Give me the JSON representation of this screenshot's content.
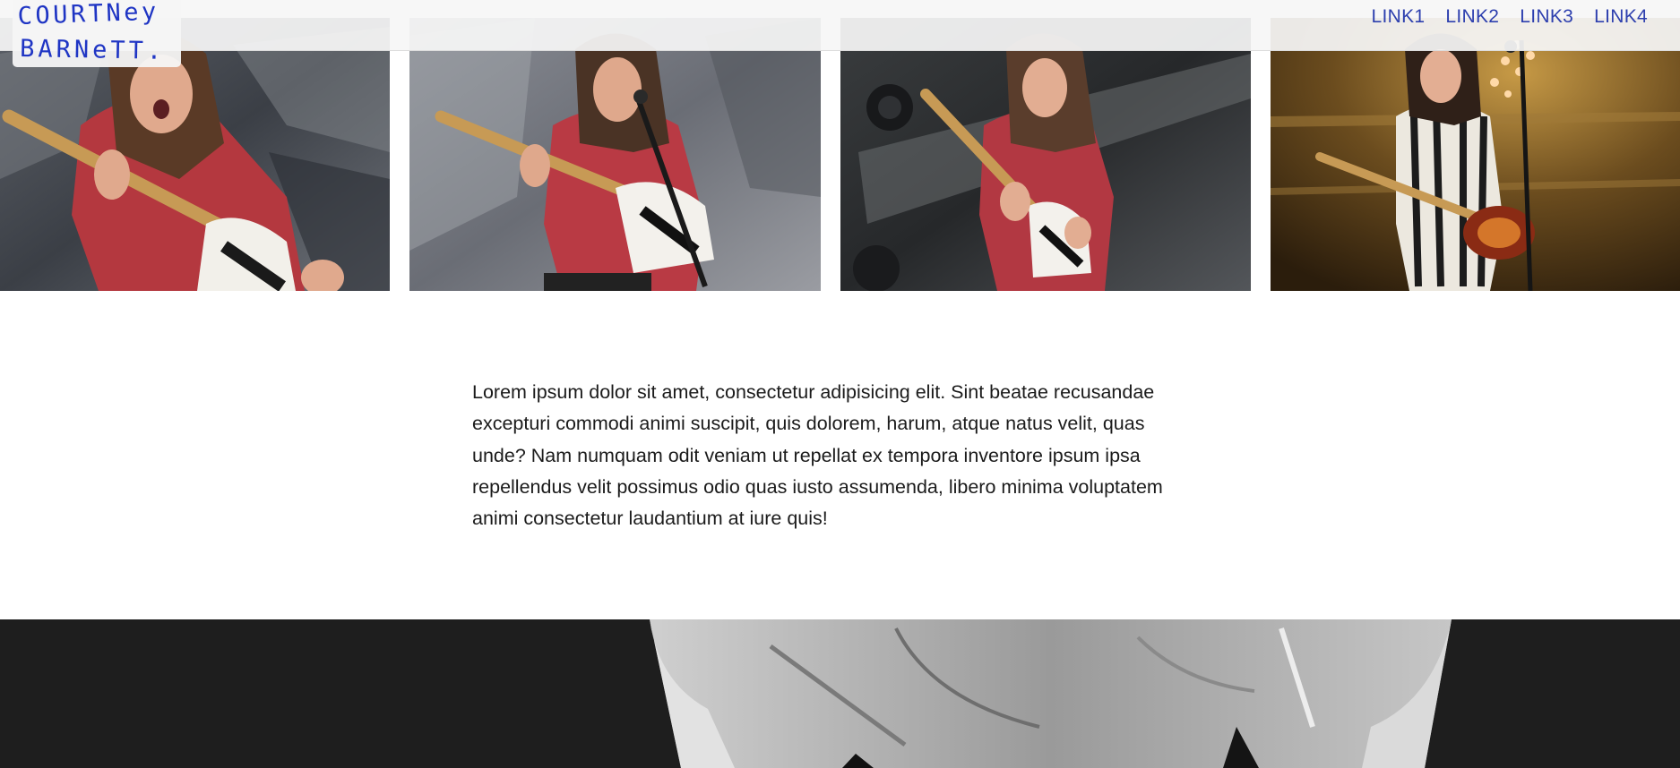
{
  "brand": {
    "line1": "COURTNey",
    "line2": "BARNeTT.",
    "color": "#1f35c4"
  },
  "nav": {
    "links": [
      "LINK1",
      "LINK2",
      "LINK3",
      "LINK4"
    ],
    "color": "#2d3fae"
  },
  "gallery": {
    "count": 4
  },
  "intro": {
    "text": "Lorem ipsum dolor sit amet, consectetur adipisicing elit. Sint beatae recusandae excepturi commodi animi suscipit, quis dolorem, harum, atque natus velit, quas unde? Nam numquam odit veniam ut repellat ex tempora inventore ipsum ipsa repellendus velit possimus odio quas iusto assumenda, libero minima voluptatem animi consectetur laudantium at iure quis!"
  }
}
